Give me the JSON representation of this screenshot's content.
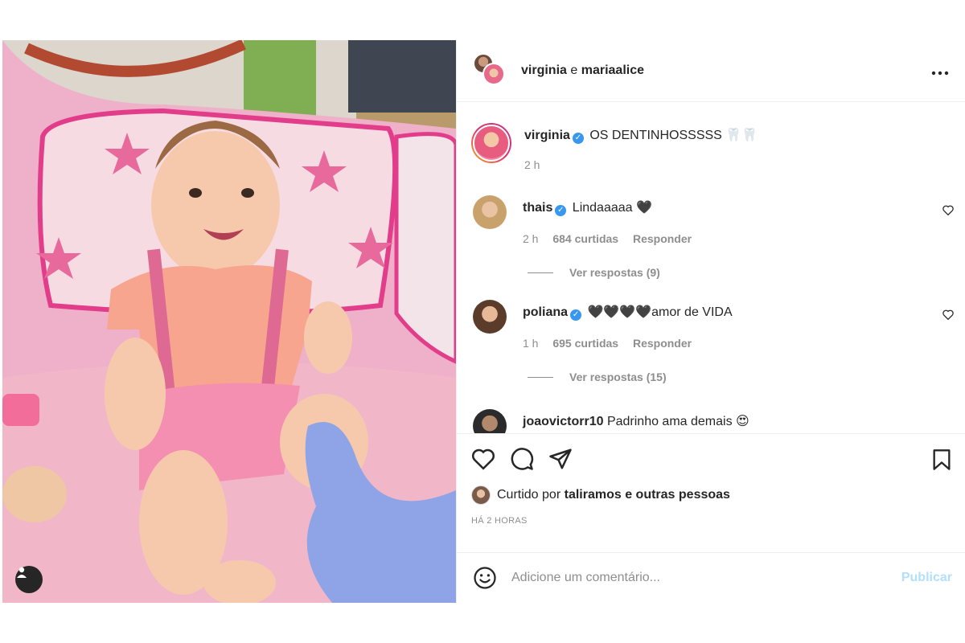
{
  "header": {
    "user1": "virginia",
    "separator": "e",
    "user2": "mariaalice",
    "more_icon": "more-horizontal-icon"
  },
  "caption": {
    "username": "virginia",
    "verified": true,
    "text": "OS DENTINHOSSSSS 🦷🦷",
    "time": "2 h"
  },
  "comments": [
    {
      "username": "thais",
      "verified": true,
      "text": "Lindaaaaa 🖤",
      "time": "2 h",
      "likes": "684 curtidas",
      "reply": "Responder",
      "view_replies": "Ver respostas (9)"
    },
    {
      "username": "poliana",
      "verified": true,
      "text": "🖤🖤🖤🖤amor de VIDA",
      "time": "1 h",
      "likes": "695 curtidas",
      "reply": "Responder",
      "view_replies": "Ver respostas (15)"
    },
    {
      "username": "joaovictorr10",
      "text": "Padrinho ama demais 😍"
    }
  ],
  "actions": {
    "icons": [
      "heart-icon",
      "comment-icon",
      "share-icon",
      "bookmark-icon"
    ]
  },
  "likes": {
    "prefix": "Curtido por",
    "user": "taliramos",
    "suffix": "e outras pessoas"
  },
  "posted_ago": "HÁ 2 HORAS",
  "add_comment": {
    "placeholder": "Adicione um comentário...",
    "publish": "Publicar"
  },
  "colors": {
    "verified": "#3897f0",
    "publish_disabled": "#b2dffc",
    "muted": "#8e8e8e"
  }
}
